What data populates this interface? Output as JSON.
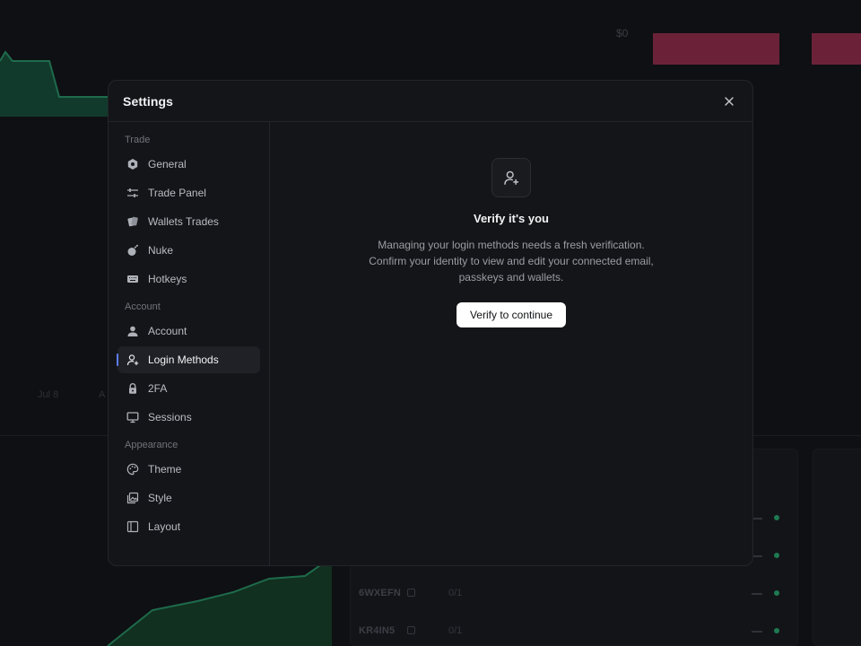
{
  "background": {
    "price_label": "$0",
    "x_labels": [
      "Jul 8",
      "A"
    ],
    "rows": [
      {
        "id": "",
        "ratio": ""
      },
      {
        "id": "",
        "ratio": ""
      },
      {
        "id": "6WXEFN",
        "ratio": "0/1"
      },
      {
        "id": "KR4IN5",
        "ratio": "0/1"
      }
    ],
    "colors": {
      "bear": "#6b2238",
      "bull": "#1e7a52"
    }
  },
  "modal": {
    "title": "Settings",
    "close_icon": "close-icon"
  },
  "sidebar": {
    "groups": [
      {
        "label": "Trade",
        "items": [
          {
            "label": "General",
            "icon": "hexagon-gear-icon"
          },
          {
            "label": "Trade Panel",
            "icon": "sliders-icon"
          },
          {
            "label": "Wallets Trades",
            "icon": "cards-icon"
          },
          {
            "label": "Nuke",
            "icon": "bomb-icon"
          },
          {
            "label": "Hotkeys",
            "icon": "keyboard-icon"
          }
        ]
      },
      {
        "label": "Account",
        "items": [
          {
            "label": "Account",
            "icon": "user-icon"
          },
          {
            "label": "Login Methods",
            "icon": "user-plus-icon",
            "active": true
          },
          {
            "label": "2FA",
            "icon": "lock-icon"
          },
          {
            "label": "Sessions",
            "icon": "monitor-icon"
          }
        ]
      },
      {
        "label": "Appearance",
        "items": [
          {
            "label": "Theme",
            "icon": "palette-icon"
          },
          {
            "label": "Style",
            "icon": "image-stack-icon"
          },
          {
            "label": "Layout",
            "icon": "layout-sidebar-icon"
          }
        ]
      }
    ]
  },
  "verify": {
    "icon": "user-plus-icon",
    "title": "Verify it's you",
    "description_lines": [
      "Managing your login methods needs a fresh verification.",
      "Confirm your identity to view and edit your connected email,",
      "passkeys and wallets."
    ],
    "button_label": "Verify to continue"
  },
  "colors": {
    "accent": "#5b7cf7",
    "modal_bg": "#141518",
    "page_bg": "#0f1013"
  }
}
